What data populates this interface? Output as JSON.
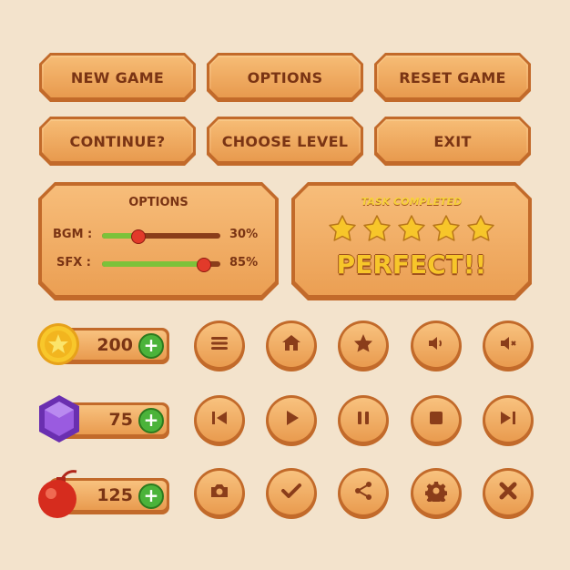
{
  "menu": {
    "new_game": "NEW GAME",
    "options": "OPTIONS",
    "reset_game": "RESET GAME",
    "continue": "CONTINUE?",
    "choose_level": "CHOOSE LEVEL",
    "exit": "EXIT"
  },
  "options_panel": {
    "title": "OPTIONS",
    "bgm_label": "BGM :",
    "bgm_value": "30%",
    "bgm_level": 0.3,
    "sfx_label": "SFX :",
    "sfx_value": "85%",
    "sfx_level": 0.85
  },
  "task_panel": {
    "subtitle": "TASK COMPLETED",
    "stars_earned": 5,
    "stars_total": 5,
    "result": "PERFECT!!"
  },
  "currencies": {
    "coins": "200",
    "gems": "75",
    "bombs": "125"
  },
  "colors": {
    "background": "#f3e3cc",
    "wood": "#eda35b",
    "text": "#7a3414",
    "accent_green": "#4bb33a",
    "star_yellow": "#f7c62a"
  },
  "icons": [
    [
      "menu-icon",
      "home-icon",
      "star-icon",
      "volume-icon",
      "mute-icon"
    ],
    [
      "previous-icon",
      "play-icon",
      "pause-icon",
      "stop-icon",
      "next-icon"
    ],
    [
      "camera-icon",
      "check-icon",
      "share-icon",
      "settings-icon",
      "close-icon"
    ]
  ]
}
